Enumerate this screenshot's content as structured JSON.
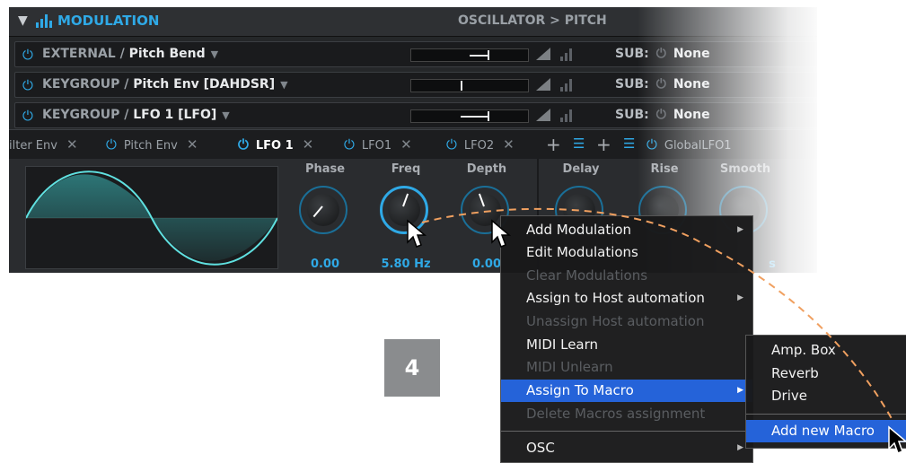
{
  "header": {
    "title": "MODULATION",
    "path": "OSCILLATOR > PITCH"
  },
  "mod_rows": [
    {
      "category": "EXTERNAL",
      "source": "Pitch Bend",
      "depth": 0.55,
      "sub_label": "SUB:",
      "sub_value": "None"
    },
    {
      "category": "KEYGROUP",
      "source": "Pitch Env [DAHDSR]",
      "depth": 0.0,
      "sub_label": "SUB:",
      "sub_value": "None"
    },
    {
      "category": "KEYGROUP",
      "source": "LFO 1 [LFO]",
      "depth": 0.55,
      "sub_label": "SUB:",
      "sub_value": "None"
    }
  ],
  "tabs": [
    {
      "label": "ilter Env",
      "active": false
    },
    {
      "label": "Pitch Env",
      "active": false
    },
    {
      "label": "LFO 1",
      "active": true
    },
    {
      "label": "LFO1",
      "active": false
    },
    {
      "label": "LFO2",
      "active": false
    },
    {
      "label": "GlobalLFO1",
      "active": false
    }
  ],
  "knobs": [
    {
      "label": "Phase",
      "value": "0.00"
    },
    {
      "label": "Freq",
      "value": "5.80 Hz"
    },
    {
      "label": "Depth",
      "value": "0.00"
    },
    {
      "label": "Delay",
      "value": ""
    },
    {
      "label": "Rise",
      "value": ""
    },
    {
      "label": "Smooth",
      "value": "s"
    }
  ],
  "step_number": "4",
  "context_menu": {
    "items": [
      {
        "label": "Add Modulation",
        "disabled": false,
        "submenu": true
      },
      {
        "label": "Edit Modulations",
        "disabled": false,
        "submenu": false
      },
      {
        "label": "Clear Modulations",
        "disabled": true,
        "submenu": false
      },
      {
        "label": "Assign to Host automation",
        "disabled": false,
        "submenu": true
      },
      {
        "label": "Unassign Host automation",
        "disabled": true,
        "submenu": false
      },
      {
        "label": "MIDI Learn",
        "disabled": false,
        "submenu": false
      },
      {
        "label": "MIDI Unlearn",
        "disabled": true,
        "submenu": false
      },
      {
        "label": "Assign To Macro",
        "disabled": false,
        "submenu": true,
        "highlighted": true
      },
      {
        "label": "Delete Macros assignment",
        "disabled": true,
        "submenu": false
      },
      {
        "label": "OSC",
        "disabled": false,
        "submenu": true
      }
    ]
  },
  "macro_submenu": {
    "items": [
      "Amp. Box",
      "Reverb",
      "Drive"
    ],
    "add_new": "Add new Macro"
  },
  "colors": {
    "accent": "#2fa9e6",
    "highlight": "#2563d9",
    "dash": "#f0a060"
  }
}
